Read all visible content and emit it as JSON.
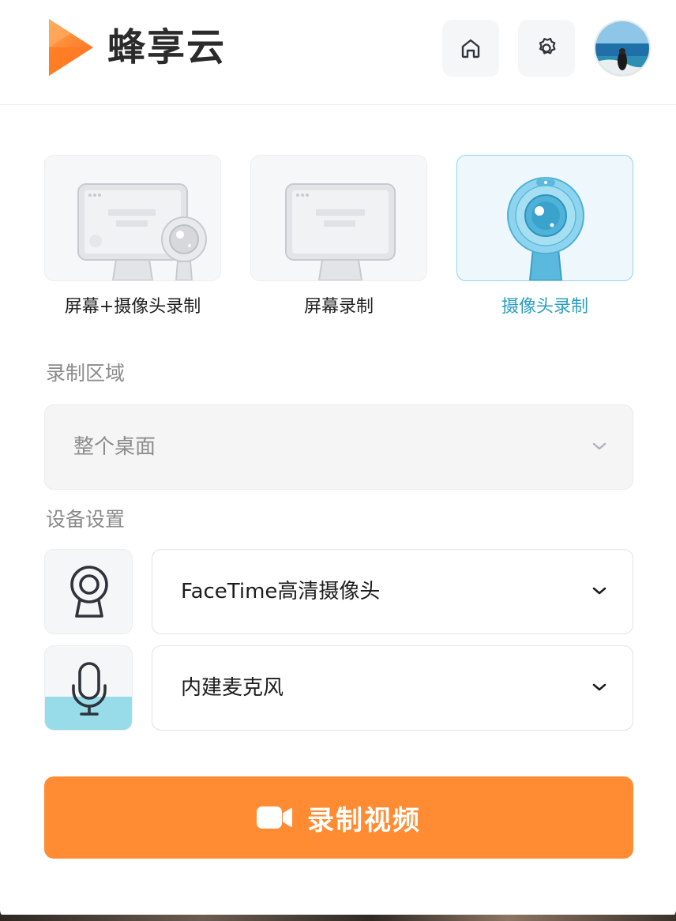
{
  "header": {
    "logo_text": "蜂享云",
    "home_icon": "home-icon",
    "settings_icon": "gear-icon",
    "avatar": "user-avatar"
  },
  "modes": [
    {
      "label": "屏幕+摄像头录制",
      "icon": "screen-camera-illustration",
      "selected": false
    },
    {
      "label": "屏幕录制",
      "icon": "screen-illustration",
      "selected": false
    },
    {
      "label": "摄像头录制",
      "icon": "webcam-illustration",
      "selected": true
    }
  ],
  "record_area": {
    "label": "录制区域",
    "value": "整个桌面"
  },
  "device_settings": {
    "label": "设备设置",
    "camera": {
      "icon": "webcam-icon",
      "value": "FaceTime高清摄像头"
    },
    "microphone": {
      "icon": "microphone-icon",
      "value": "内建麦克风",
      "input_level": 0.4
    }
  },
  "record_button": {
    "label": "录制视频",
    "icon": "video-camera-icon"
  },
  "colors": {
    "accent": "#ff8c33",
    "selected": "#2a9fc4",
    "selected_border": "#8fd3ea",
    "mic_level": "#98dcea"
  }
}
